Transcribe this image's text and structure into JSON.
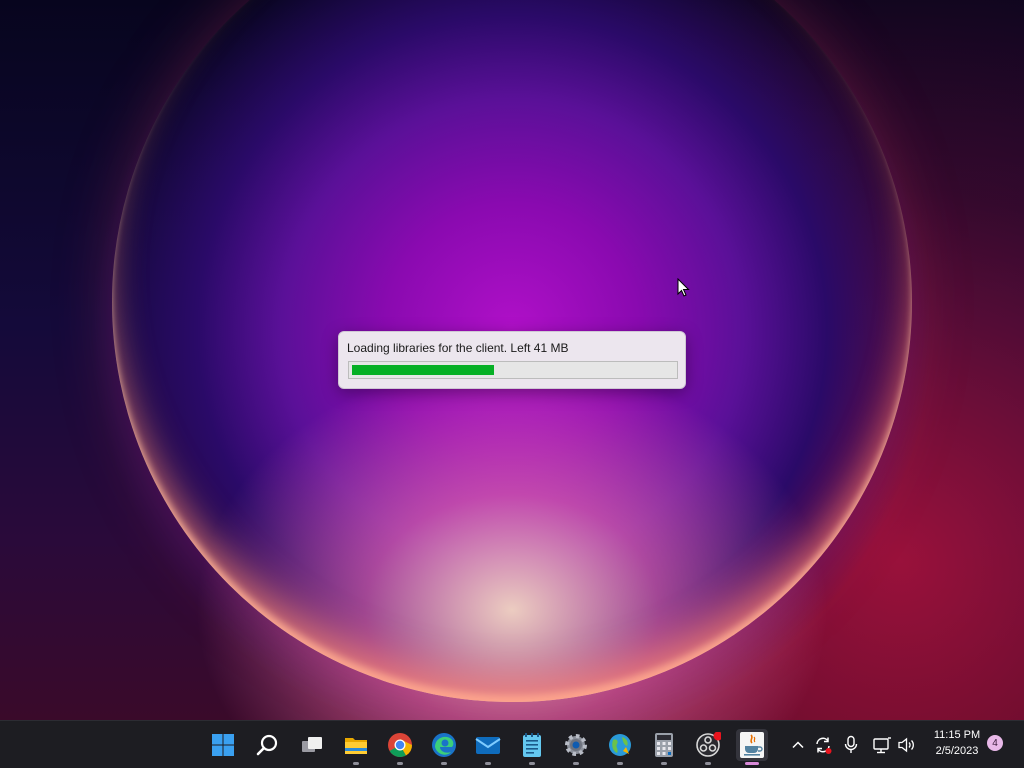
{
  "loading_dialog": {
    "message": "Loading libraries for the client. Left 41 MB",
    "progress_fraction": 0.44,
    "progress_color": "#06b025"
  },
  "taskbar": {
    "apps": [
      {
        "name": "start",
        "icon": "windows-logo-icon"
      },
      {
        "name": "search",
        "icon": "search-icon"
      },
      {
        "name": "task-view",
        "icon": "task-view-icon"
      },
      {
        "name": "file-explorer",
        "icon": "folder-icon"
      },
      {
        "name": "chrome",
        "icon": "chrome-icon"
      },
      {
        "name": "edge",
        "icon": "edge-icon"
      },
      {
        "name": "mail",
        "icon": "mail-icon"
      },
      {
        "name": "notepad",
        "icon": "notepad-icon"
      },
      {
        "name": "settings",
        "icon": "gear-icon"
      },
      {
        "name": "maps",
        "icon": "globe-icon"
      },
      {
        "name": "calculator",
        "icon": "calculator-icon"
      },
      {
        "name": "obs",
        "icon": "obs-icon"
      },
      {
        "name": "java",
        "icon": "java-icon",
        "active": true
      }
    ],
    "tray": {
      "chevron": "chevron-up-icon",
      "sync": "sync-icon",
      "mic": "microphone-icon",
      "network": "network-icon",
      "volume": "volume-icon"
    },
    "clock": {
      "time": "11:15 PM",
      "date": "2/5/2023"
    },
    "notification_count": "4"
  }
}
